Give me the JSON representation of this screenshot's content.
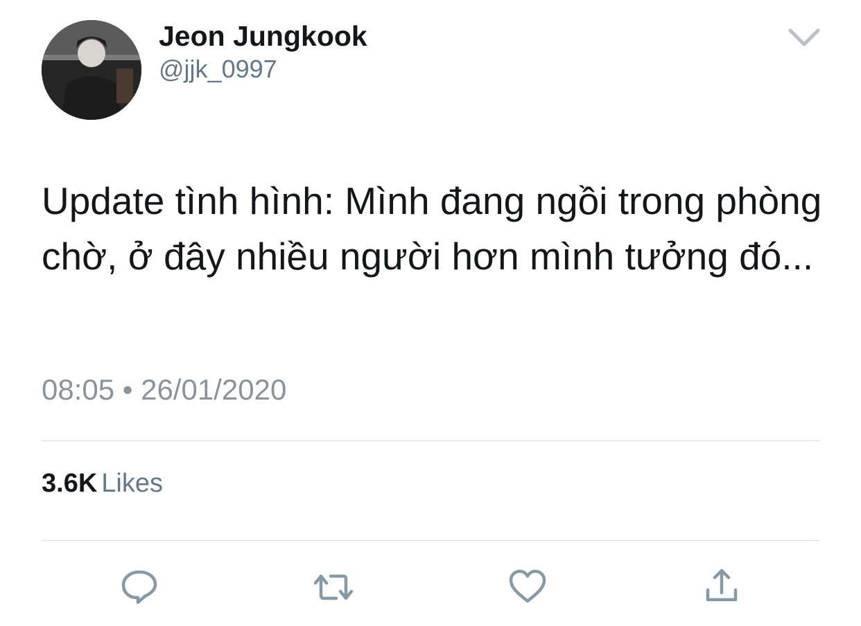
{
  "tweet": {
    "author": {
      "display_name": "Jeon Jungkook",
      "handle": "@jjk_0997"
    },
    "text": "Update tình hình: Mình đang ngồi trong phòng chờ, ở đây nhiều người hơn mình tưởng đó...",
    "timestamp": "08:05 • 26/01/2020",
    "stats": {
      "likes_count": "3.6K",
      "likes_label": "Likes"
    }
  },
  "icons": {
    "menu": "chevron-down-icon",
    "reply": "reply-icon",
    "retweet": "retweet-icon",
    "like": "heart-icon",
    "share": "share-icon"
  },
  "colors": {
    "text_primary": "#14171a",
    "text_secondary": "#657786",
    "timestamp": "#8a939b",
    "icon": "#8899a6",
    "divider": "#d8dde1"
  }
}
